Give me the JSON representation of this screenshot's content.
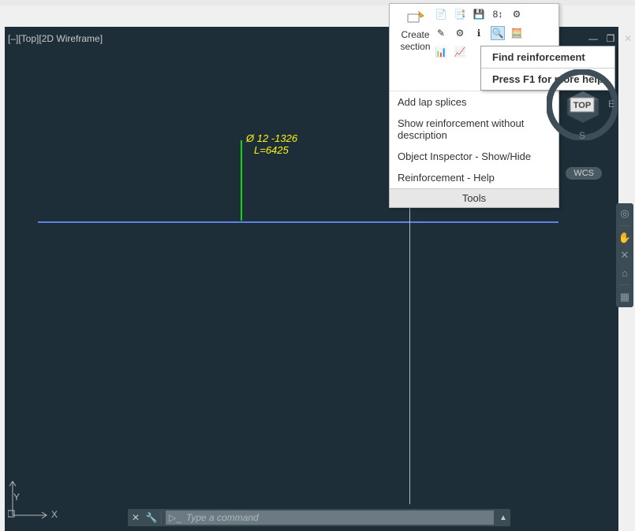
{
  "viewport_label": "[–][Top][2D Wireframe]",
  "annotation": {
    "line1": "Ø 12 -1326",
    "line2": "L=6425"
  },
  "ucs": {
    "y": "Y",
    "x": "X"
  },
  "cmd": {
    "placeholder": "Type a command",
    "close": "✕",
    "wrench": "🔧",
    "prompt": "▷_",
    "up": "▲"
  },
  "dropdown": {
    "create": "Create section",
    "items": [
      "Add lap splices",
      "Show reinforcement without description",
      "Object Inspector - Show/Hide",
      "Reinforcement - Help"
    ],
    "footer": "Tools"
  },
  "toolbar_icons": [
    "📄",
    "📑",
    "💾",
    "8↕",
    "⚙",
    "✎",
    "⚙",
    "ℹ",
    "🔍",
    "🧮",
    "📊",
    "📈"
  ],
  "tooltip": {
    "title": "Find reinforcement",
    "help": "Press F1 for more help"
  },
  "viewcube": {
    "top": "TOP",
    "e": "E",
    "s": "S"
  },
  "wcs": "WCS",
  "side_icons": [
    "◎",
    "✋",
    "✕",
    "⌂",
    "▦"
  ]
}
